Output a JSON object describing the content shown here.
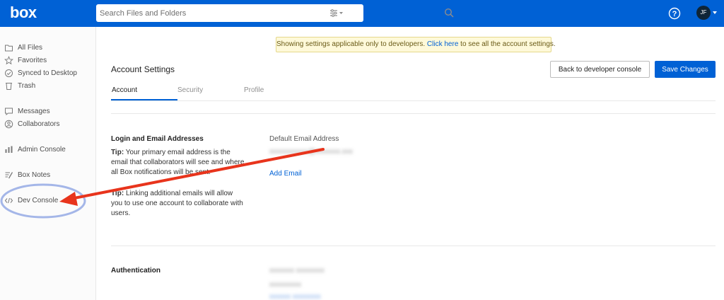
{
  "header": {
    "logo": "box",
    "search": {
      "placeholder": "Search Files and Folders"
    },
    "avatar_initials": "JF",
    "icons": {
      "filter": "filter-icon",
      "search": "search-icon",
      "help": "help-icon",
      "caret": "caret-down-icon"
    }
  },
  "sidebar": {
    "items": [
      {
        "label": "All Files",
        "icon": "folder-icon"
      },
      {
        "label": "Favorites",
        "icon": "star-icon"
      },
      {
        "label": "Synced to Desktop",
        "icon": "check-circle-icon"
      },
      {
        "label": "Trash",
        "icon": "trash-icon"
      },
      {
        "label": "Messages",
        "icon": "message-icon"
      },
      {
        "label": "Collaborators",
        "icon": "person-icon"
      },
      {
        "label": "Admin Console",
        "icon": "bar-chart-icon"
      },
      {
        "label": "Box Notes",
        "icon": "notes-icon"
      },
      {
        "label": "Dev Console",
        "icon": "code-icon"
      }
    ]
  },
  "banner": {
    "text_before": "Showing settings applicable only to developers.",
    "link": "Click here",
    "text_after": "to see all the account settings."
  },
  "main": {
    "title": "Account Settings",
    "buttons": {
      "back": "Back to developer console",
      "save": "Save Changes"
    },
    "tabs": [
      {
        "label": "Account",
        "active": true
      },
      {
        "label": "Security",
        "active": false
      },
      {
        "label": "Profile",
        "active": false
      }
    ],
    "login_section": {
      "heading": "Login and Email Addresses",
      "tip1_label": "Tip:",
      "tip1_text": "Your primary email address is the email that collaborators will see and where all Box notifications will be sent.",
      "tip2_label": "Tip:",
      "tip2_text": "Linking additional emails will allow you to use one account to collaborate with users.",
      "default_email_label": "Default Email Address",
      "add_email": "Add Email"
    },
    "auth_section": {
      "heading": "Authentication"
    }
  },
  "colors": {
    "brand": "#0061d5",
    "annotation_arrow": "#e8341c",
    "annotation_ellipse": "#9aaee6"
  }
}
